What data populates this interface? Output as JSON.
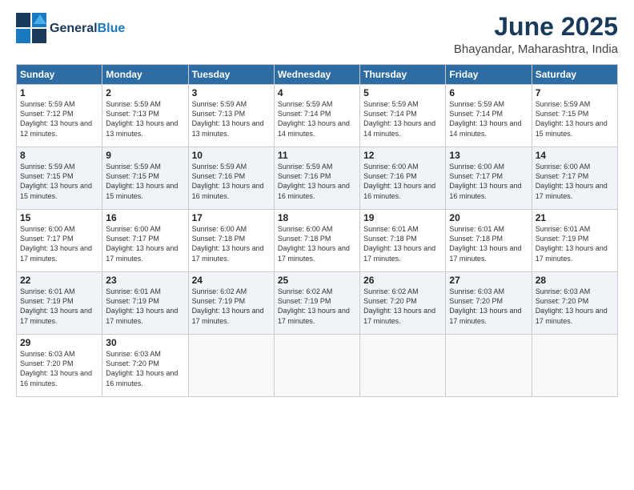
{
  "header": {
    "logo_general": "General",
    "logo_blue": "Blue",
    "title": "June 2025",
    "subtitle": "Bhayandar, Maharashtra, India"
  },
  "weekdays": [
    "Sunday",
    "Monday",
    "Tuesday",
    "Wednesday",
    "Thursday",
    "Friday",
    "Saturday"
  ],
  "weeks": [
    [
      {
        "day": "1",
        "sunrise": "Sunrise: 5:59 AM",
        "sunset": "Sunset: 7:12 PM",
        "daylight": "Daylight: 13 hours and 12 minutes."
      },
      {
        "day": "2",
        "sunrise": "Sunrise: 5:59 AM",
        "sunset": "Sunset: 7:13 PM",
        "daylight": "Daylight: 13 hours and 13 minutes."
      },
      {
        "day": "3",
        "sunrise": "Sunrise: 5:59 AM",
        "sunset": "Sunset: 7:13 PM",
        "daylight": "Daylight: 13 hours and 13 minutes."
      },
      {
        "day": "4",
        "sunrise": "Sunrise: 5:59 AM",
        "sunset": "Sunset: 7:14 PM",
        "daylight": "Daylight: 13 hours and 14 minutes."
      },
      {
        "day": "5",
        "sunrise": "Sunrise: 5:59 AM",
        "sunset": "Sunset: 7:14 PM",
        "daylight": "Daylight: 13 hours and 14 minutes."
      },
      {
        "day": "6",
        "sunrise": "Sunrise: 5:59 AM",
        "sunset": "Sunset: 7:14 PM",
        "daylight": "Daylight: 13 hours and 14 minutes."
      },
      {
        "day": "7",
        "sunrise": "Sunrise: 5:59 AM",
        "sunset": "Sunset: 7:15 PM",
        "daylight": "Daylight: 13 hours and 15 minutes."
      }
    ],
    [
      {
        "day": "8",
        "sunrise": "Sunrise: 5:59 AM",
        "sunset": "Sunset: 7:15 PM",
        "daylight": "Daylight: 13 hours and 15 minutes."
      },
      {
        "day": "9",
        "sunrise": "Sunrise: 5:59 AM",
        "sunset": "Sunset: 7:15 PM",
        "daylight": "Daylight: 13 hours and 15 minutes."
      },
      {
        "day": "10",
        "sunrise": "Sunrise: 5:59 AM",
        "sunset": "Sunset: 7:16 PM",
        "daylight": "Daylight: 13 hours and 16 minutes."
      },
      {
        "day": "11",
        "sunrise": "Sunrise: 5:59 AM",
        "sunset": "Sunset: 7:16 PM",
        "daylight": "Daylight: 13 hours and 16 minutes."
      },
      {
        "day": "12",
        "sunrise": "Sunrise: 6:00 AM",
        "sunset": "Sunset: 7:16 PM",
        "daylight": "Daylight: 13 hours and 16 minutes."
      },
      {
        "day": "13",
        "sunrise": "Sunrise: 6:00 AM",
        "sunset": "Sunset: 7:17 PM",
        "daylight": "Daylight: 13 hours and 16 minutes."
      },
      {
        "day": "14",
        "sunrise": "Sunrise: 6:00 AM",
        "sunset": "Sunset: 7:17 PM",
        "daylight": "Daylight: 13 hours and 17 minutes."
      }
    ],
    [
      {
        "day": "15",
        "sunrise": "Sunrise: 6:00 AM",
        "sunset": "Sunset: 7:17 PM",
        "daylight": "Daylight: 13 hours and 17 minutes."
      },
      {
        "day": "16",
        "sunrise": "Sunrise: 6:00 AM",
        "sunset": "Sunset: 7:17 PM",
        "daylight": "Daylight: 13 hours and 17 minutes."
      },
      {
        "day": "17",
        "sunrise": "Sunrise: 6:00 AM",
        "sunset": "Sunset: 7:18 PM",
        "daylight": "Daylight: 13 hours and 17 minutes."
      },
      {
        "day": "18",
        "sunrise": "Sunrise: 6:00 AM",
        "sunset": "Sunset: 7:18 PM",
        "daylight": "Daylight: 13 hours and 17 minutes."
      },
      {
        "day": "19",
        "sunrise": "Sunrise: 6:01 AM",
        "sunset": "Sunset: 7:18 PM",
        "daylight": "Daylight: 13 hours and 17 minutes."
      },
      {
        "day": "20",
        "sunrise": "Sunrise: 6:01 AM",
        "sunset": "Sunset: 7:18 PM",
        "daylight": "Daylight: 13 hours and 17 minutes."
      },
      {
        "day": "21",
        "sunrise": "Sunrise: 6:01 AM",
        "sunset": "Sunset: 7:19 PM",
        "daylight": "Daylight: 13 hours and 17 minutes."
      }
    ],
    [
      {
        "day": "22",
        "sunrise": "Sunrise: 6:01 AM",
        "sunset": "Sunset: 7:19 PM",
        "daylight": "Daylight: 13 hours and 17 minutes."
      },
      {
        "day": "23",
        "sunrise": "Sunrise: 6:01 AM",
        "sunset": "Sunset: 7:19 PM",
        "daylight": "Daylight: 13 hours and 17 minutes."
      },
      {
        "day": "24",
        "sunrise": "Sunrise: 6:02 AM",
        "sunset": "Sunset: 7:19 PM",
        "daylight": "Daylight: 13 hours and 17 minutes."
      },
      {
        "day": "25",
        "sunrise": "Sunrise: 6:02 AM",
        "sunset": "Sunset: 7:19 PM",
        "daylight": "Daylight: 13 hours and 17 minutes."
      },
      {
        "day": "26",
        "sunrise": "Sunrise: 6:02 AM",
        "sunset": "Sunset: 7:20 PM",
        "daylight": "Daylight: 13 hours and 17 minutes."
      },
      {
        "day": "27",
        "sunrise": "Sunrise: 6:03 AM",
        "sunset": "Sunset: 7:20 PM",
        "daylight": "Daylight: 13 hours and 17 minutes."
      },
      {
        "day": "28",
        "sunrise": "Sunrise: 6:03 AM",
        "sunset": "Sunset: 7:20 PM",
        "daylight": "Daylight: 13 hours and 17 minutes."
      }
    ],
    [
      {
        "day": "29",
        "sunrise": "Sunrise: 6:03 AM",
        "sunset": "Sunset: 7:20 PM",
        "daylight": "Daylight: 13 hours and 16 minutes."
      },
      {
        "day": "30",
        "sunrise": "Sunrise: 6:03 AM",
        "sunset": "Sunset: 7:20 PM",
        "daylight": "Daylight: 13 hours and 16 minutes."
      },
      null,
      null,
      null,
      null,
      null
    ]
  ]
}
